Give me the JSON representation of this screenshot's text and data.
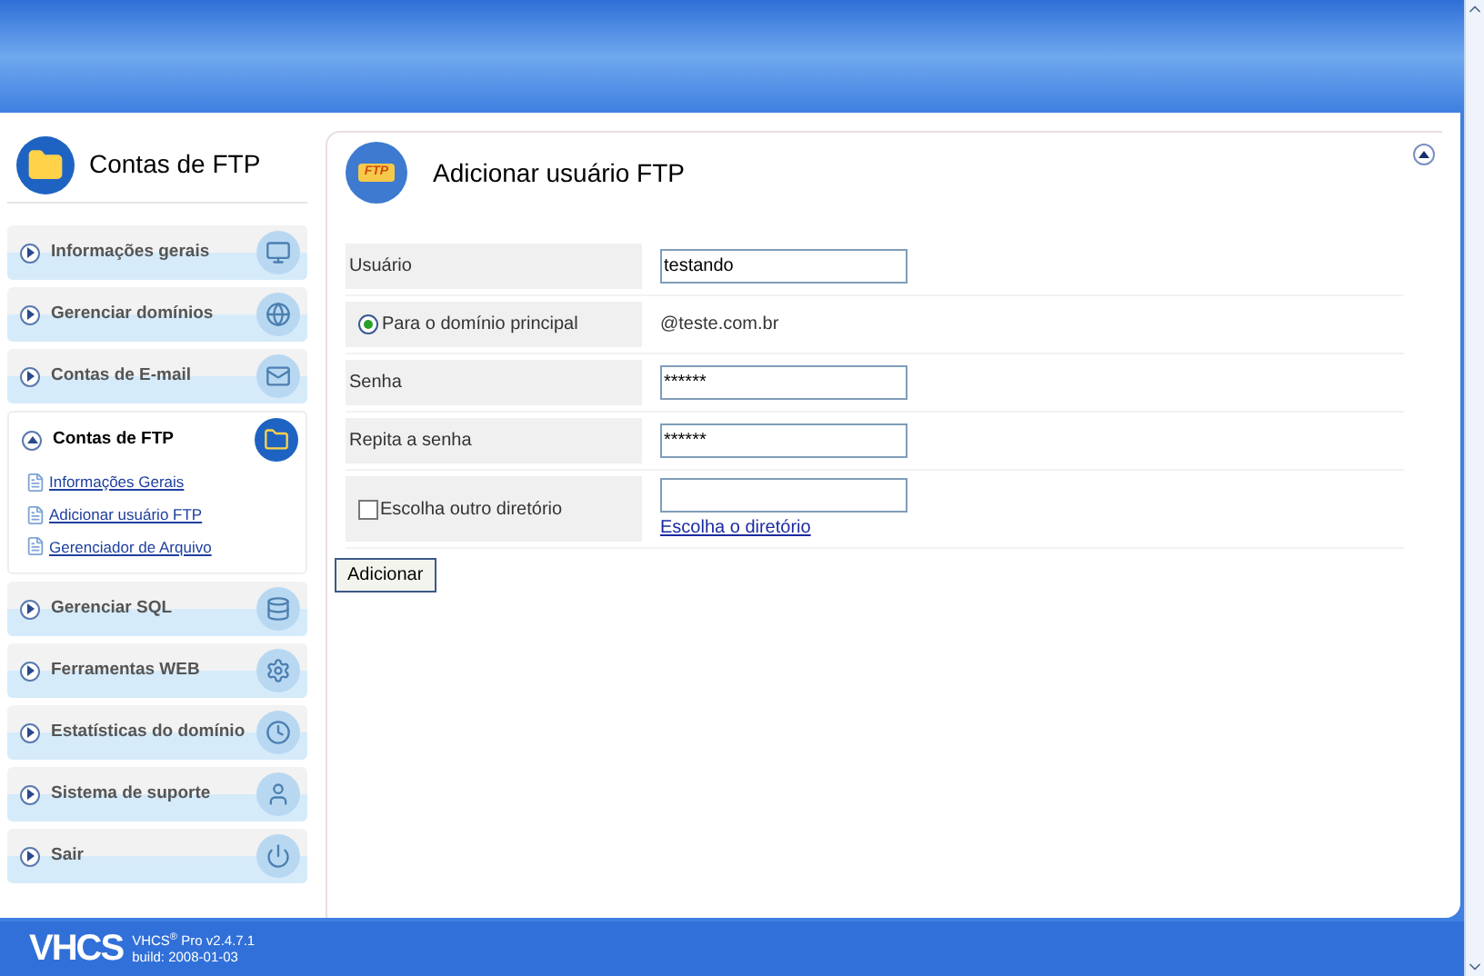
{
  "sidebar": {
    "title": "Contas de FTP",
    "items": [
      {
        "label": "Informações gerais",
        "expanded": false
      },
      {
        "label": "Gerenciar domínios",
        "expanded": false
      },
      {
        "label": "Contas de E-mail",
        "expanded": false
      },
      {
        "label": "Contas de FTP",
        "expanded": true,
        "children": [
          {
            "label": "Informações Gerais"
          },
          {
            "label": "Adicionar usuário FTP"
          },
          {
            "label": "Gerenciador de Arquivo"
          }
        ]
      },
      {
        "label": "Gerenciar SQL",
        "expanded": false
      },
      {
        "label": "Ferramentas WEB",
        "expanded": false
      },
      {
        "label": "Estatísticas do domínio",
        "expanded": false
      },
      {
        "label": "Sistema de suporte",
        "expanded": false
      },
      {
        "label": "Sair",
        "expanded": false
      }
    ]
  },
  "panel": {
    "title": "Adicionar usuário FTP",
    "icon_label": "FTP",
    "rows": [
      {
        "kind": "text",
        "label": "Usuário",
        "value": "testando"
      },
      {
        "kind": "radio",
        "label": "Para o domínio principal",
        "selected": true,
        "value": "@teste.com.br"
      },
      {
        "kind": "text",
        "label": "Senha",
        "value": "******"
      },
      {
        "kind": "text",
        "label": "Repita a senha",
        "value": "******"
      },
      {
        "kind": "checkbox",
        "label": "Escolha outro diretório",
        "checked": false,
        "link": "Escolha o diretório"
      }
    ],
    "button": "Adicionar"
  },
  "footer": {
    "logo": "VHCS",
    "version": "VHCS$^{®}$ Pro v2.4.7.1",
    "build": "build: 2008-01-03"
  }
}
